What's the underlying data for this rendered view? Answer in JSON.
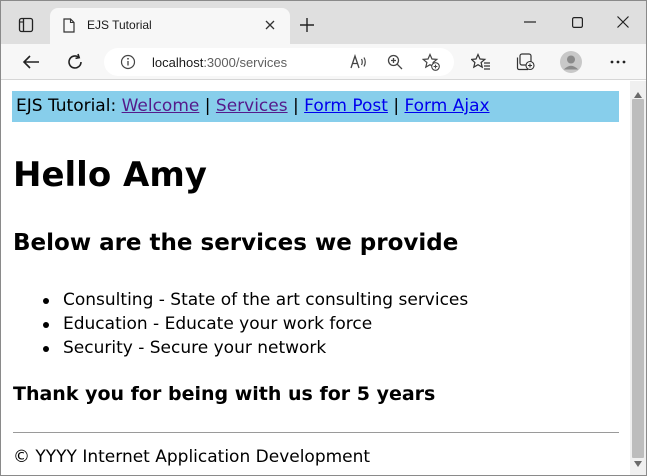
{
  "browser": {
    "tab": {
      "title": "EJS Tutorial"
    },
    "address": {
      "host": "localhost",
      "path": ":3000/services"
    }
  },
  "page": {
    "nav": {
      "prefix": "EJS Tutorial:",
      "separator": "|",
      "links": [
        {
          "label": "Welcome",
          "visited": true
        },
        {
          "label": "Services",
          "visited": true
        },
        {
          "label": "Form Post",
          "visited": false
        },
        {
          "label": "Form Ajax",
          "visited": false
        }
      ]
    },
    "greeting": "Hello Amy",
    "subheading": "Below are the services we provide",
    "services": [
      "Consulting - State of the art consulting services",
      "Education - Educate your work force",
      "Security - Secure your network"
    ],
    "thanks": "Thank you for being with us for 5 years",
    "footer": "© YYYY Internet Application Development"
  },
  "colors": {
    "nav_background": "#87ceeb",
    "link": "#0000ee",
    "link_visited": "#551a8b"
  },
  "icons": [
    "tab-actions-icon",
    "page-favicon-icon",
    "close-tab-icon",
    "new-tab-icon",
    "minimize-icon",
    "maximize-icon",
    "close-window-icon",
    "back-icon",
    "refresh-icon",
    "site-info-icon",
    "read-aloud-icon",
    "zoom-icon",
    "add-favorite-icon",
    "favorites-icon",
    "collections-icon",
    "profile-avatar-icon",
    "more-menu-icon"
  ]
}
